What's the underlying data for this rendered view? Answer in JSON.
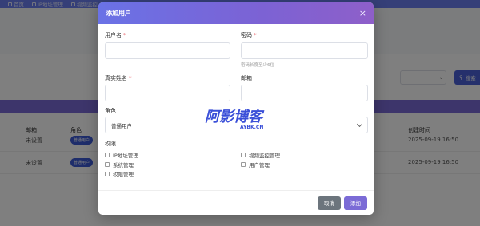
{
  "nav": {
    "items": [
      {
        "label": "首页"
      },
      {
        "label": "IP地址管理"
      },
      {
        "label": "视频监控"
      },
      {
        "label": "系统设置"
      }
    ]
  },
  "background": {
    "search_button": "搜索",
    "table_headers": {
      "email": "邮箱",
      "role": "角色",
      "created": "创建时间"
    },
    "rows": [
      {
        "email": "未设置",
        "role": "普通用户",
        "created": "2025-09-19 16:50"
      },
      {
        "email": "未设置",
        "role": "普通用户",
        "created": "2025-09-19 16:50"
      }
    ]
  },
  "modal": {
    "title": "添加用户",
    "close_glyph": "×",
    "username_label": "用户名",
    "password_label": "密码",
    "password_hint": "密码长度至少6位",
    "realname_label": "真实姓名",
    "email_label": "邮箱",
    "role_label": "角色",
    "role_selected": "普通用户",
    "required_mark": "*",
    "permissions_label": "权限",
    "permissions": [
      {
        "label": "IP地址管理",
        "checked": false
      },
      {
        "label": "视频监控管理",
        "checked": false
      },
      {
        "label": "系统管理",
        "checked": false
      },
      {
        "label": "用户管理",
        "checked": false
      },
      {
        "label": "权限管理",
        "checked": false
      }
    ],
    "cancel_label": "取消",
    "add_label": "添加"
  },
  "watermark": {
    "main": "阿影博客",
    "sub": "AYBK.CN"
  },
  "colors": {
    "header_gradient_start": "#6a72e6",
    "header_gradient_end": "#8e5fc9",
    "primary_button": "#7b6bd6",
    "cancel_button": "#6c757d",
    "required": "#e5484d"
  }
}
